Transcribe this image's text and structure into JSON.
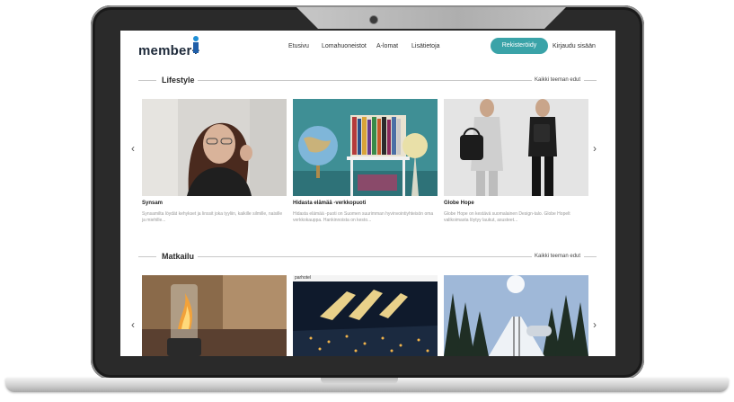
{
  "header": {
    "logo": "member+",
    "nav": [
      "Etusivu",
      "Lomahuoneistot",
      "A-lomat",
      "Lisätietoja"
    ],
    "register_label": "Rekisteröidy",
    "login_label": "Kirjaudu sisään"
  },
  "sections": [
    {
      "title": "Lifestyle",
      "link": "Kaikki teeman edut",
      "cards": [
        {
          "title": "Synsam",
          "desc": "Synsamilta löydät kehykset ja linssit joka tyyliin, kaikille silmille, naisille ja miehille..."
        },
        {
          "title": "Hidasta elämää -verkkopuoti",
          "desc": "Hidasta elämää -puoti on Suomen suurimman hyvinvointiyhteisön oma verkkokauppa. Hankinnoista on kesto..."
        },
        {
          "title": "Globe Hope",
          "desc": "Globe Hope on kestävä suomalainen Design-talo. Globe Hopelt valikoimasta löytyy laukut, asusteet..."
        }
      ]
    },
    {
      "title": "Matkailu",
      "link": "Kaikki teeman edut",
      "cards": [
        {
          "title": "",
          "desc": ""
        },
        {
          "title": "",
          "desc": "",
          "badge": "parhotel"
        },
        {
          "title": "",
          "desc": ""
        }
      ]
    }
  ],
  "colors": {
    "accent": "#3aa3a8",
    "text": "#222222",
    "muted": "#999999"
  },
  "icons": {
    "prev": "chevron-left-icon",
    "next": "chevron-right-icon"
  }
}
